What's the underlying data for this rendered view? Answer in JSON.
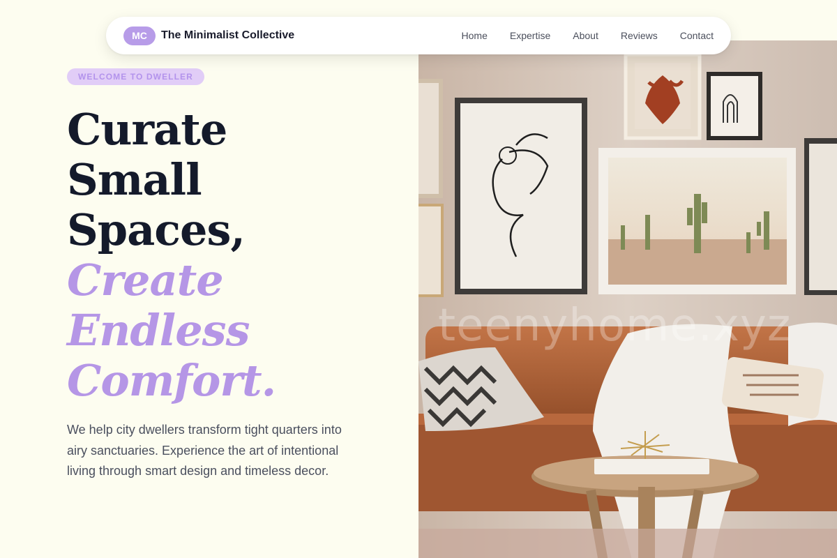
{
  "nav": {
    "logo_text": "MC",
    "brand": "The Minimalist Collective",
    "links": [
      "Home",
      "Expertise",
      "About",
      "Reviews",
      "Contact"
    ]
  },
  "hero": {
    "eyebrow": "WELCOME TO DWELLER",
    "headline_lines": [
      "Curate",
      "Small",
      "Spaces,"
    ],
    "accent_lines": [
      "Create",
      "Endless",
      "Comfort."
    ],
    "description": "We help city dwellers transform tight quarters into airy sanctuaries. Experience the art of intentional living through smart design and timeless decor.",
    "image_watermark": "teenyhome.xyz"
  },
  "colors": {
    "page_bg": "#fdfdf0",
    "accent": "#b596e6",
    "badge_bg": "#b79ce8",
    "eyebrow_bg": "#e1cdf7",
    "heading": "#141a2b",
    "body_text": "#4a4f5e"
  }
}
